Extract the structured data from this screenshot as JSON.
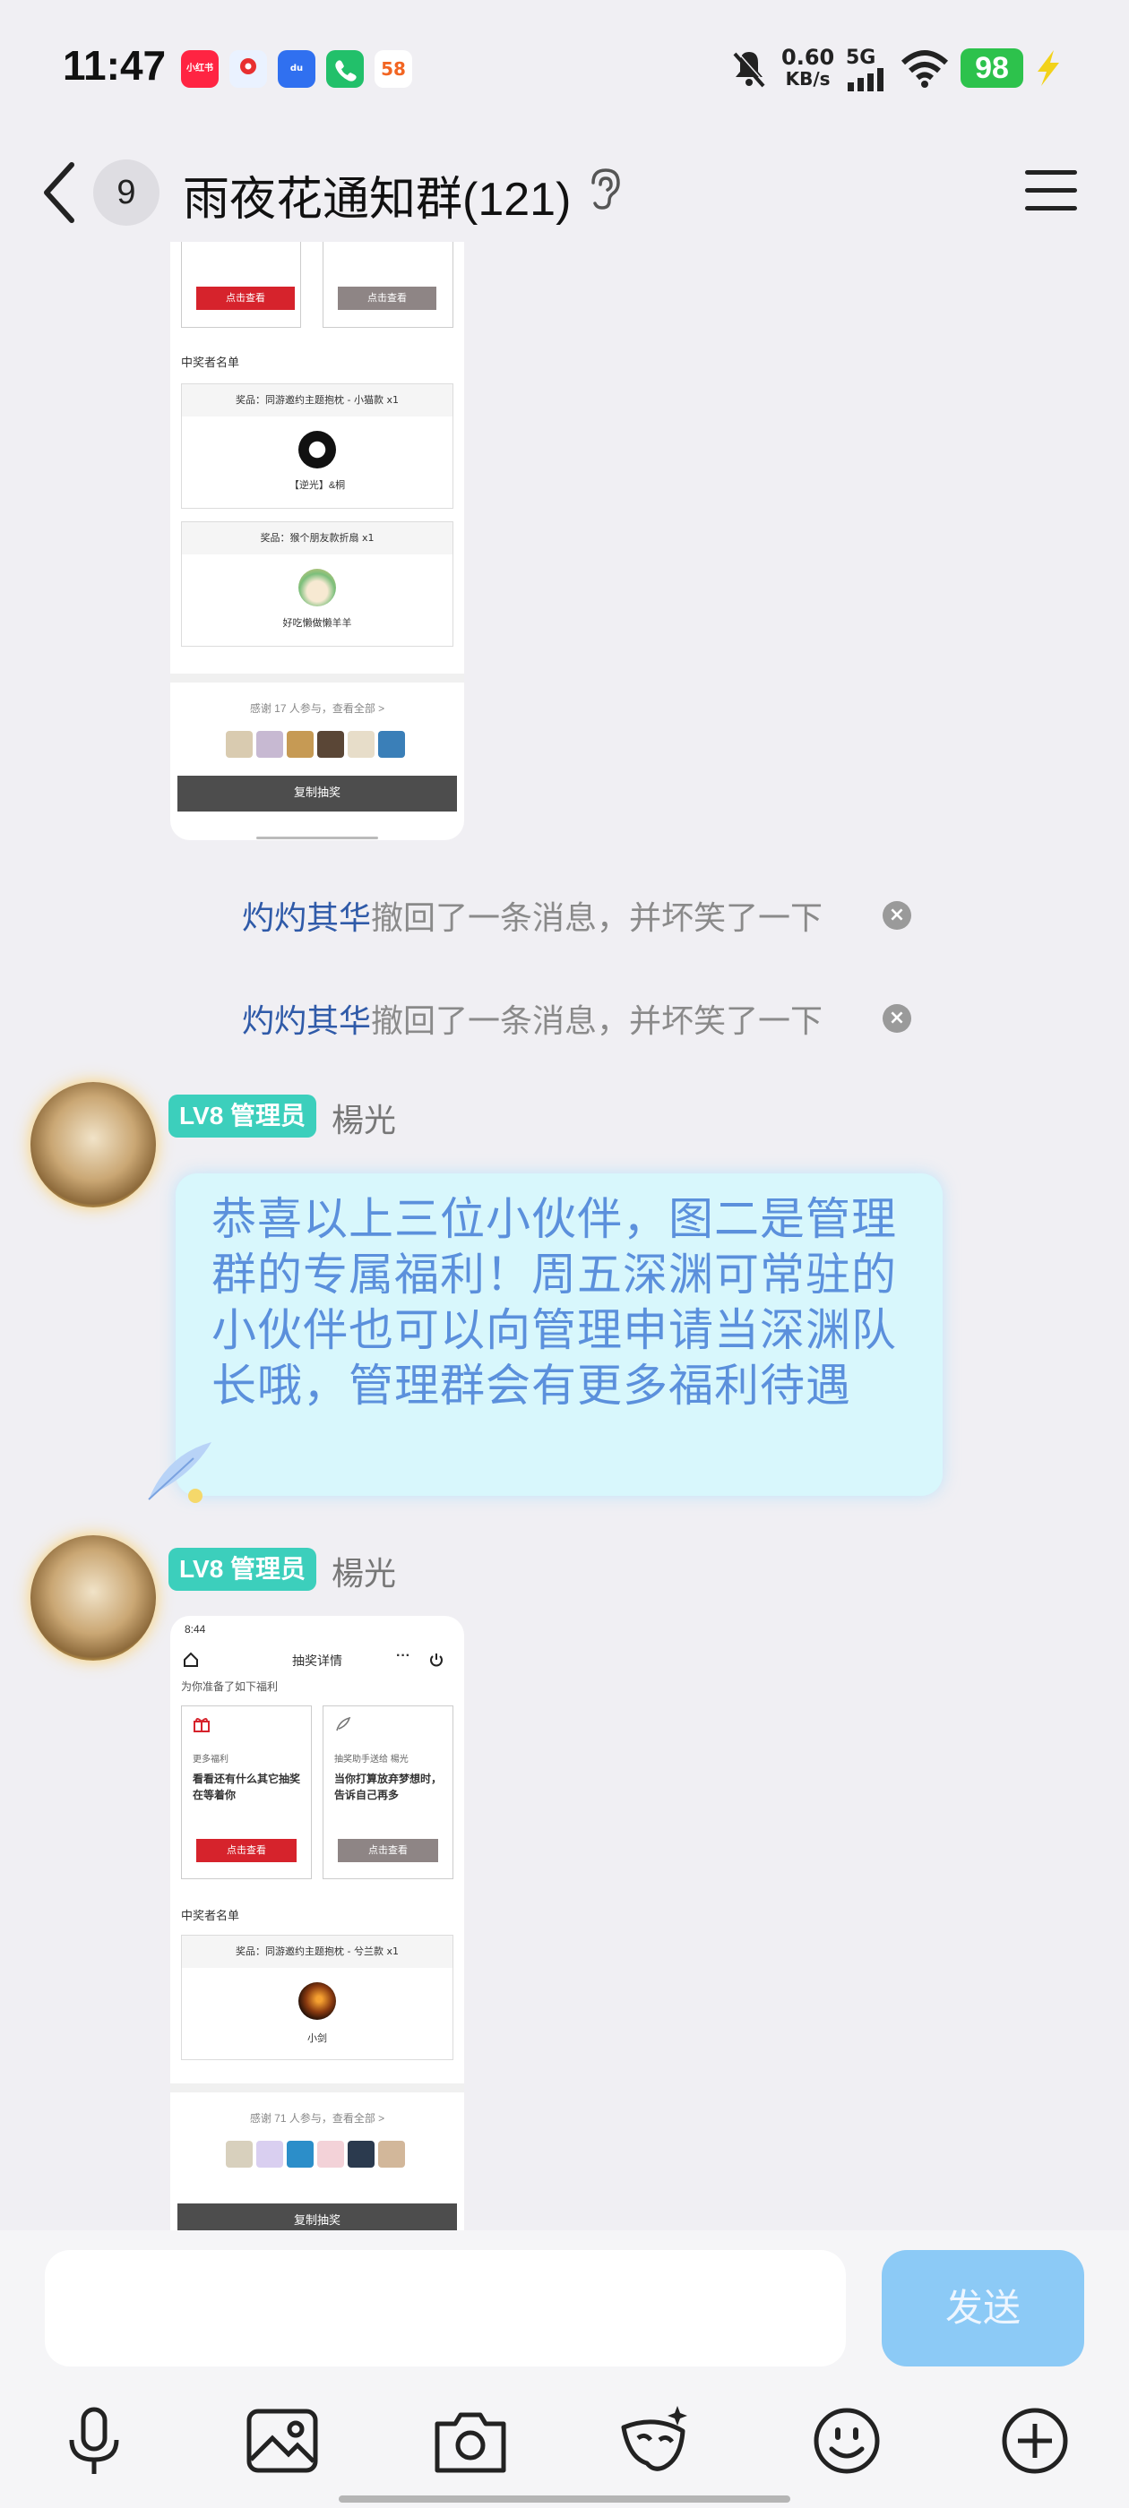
{
  "status_bar": {
    "time": "11:47",
    "apps": [
      {
        "icon": "xiaohongshu-icon",
        "label": "小红书",
        "color": "#ff2442"
      },
      {
        "icon": "map-icon",
        "label": "du",
        "color": "#e8f2ff"
      },
      {
        "icon": "baidu-icon",
        "label": "du",
        "color": "#3070f0"
      },
      {
        "icon": "phone-icon",
        "label": "",
        "color": "#22c06a"
      },
      {
        "icon": "58-icon",
        "label": "58",
        "color": "#ffffff"
      }
    ],
    "net_speed_value": "0.60",
    "net_speed_unit": "KB/s",
    "network": "5G",
    "battery": "98"
  },
  "header": {
    "unread_count": "9",
    "title": "雨夜花通知群(121)"
  },
  "card1": {
    "btn_left": "点击查看",
    "btn_right": "点击查看",
    "winners_heading": "中奖者名单",
    "prizes": [
      {
        "title": "奖品：同游邀约主题抱枕 - 小猫款 x1",
        "winner": "【逆光】&桐"
      },
      {
        "title": "奖品：猴个朋友款折扇 x1",
        "winner": "好吃懒做懒羊羊"
      }
    ],
    "thanks": "感谢 17 人参与，查看全部 >",
    "copy_label": "复制抽奖"
  },
  "recalls": [
    {
      "who": "灼灼其华",
      "text": "撤回了一条消息，并坏笑了一下"
    },
    {
      "who": "灼灼其华",
      "text": "撤回了一条消息，并坏笑了一下"
    }
  ],
  "messages": [
    {
      "level": "LV8 管理员",
      "sender": "楊光",
      "text": "恭喜以上三位小伙伴，图二是管理群的专属福利！周五深渊可常驻的小伙伴也可以向管理申请当深渊队长哦，管理群会有更多福利待遇"
    },
    {
      "level": "LV8 管理员",
      "sender": "楊光"
    }
  ],
  "card2": {
    "time": "8:44",
    "page_title": "抽奖详情",
    "more": "···",
    "prepared": "为你准备了如下福利",
    "left_box": {
      "tag": "更多福利",
      "text": "看看还有什么其它抽奖在等着你",
      "btn": "点击查看"
    },
    "right_box": {
      "tag": "抽奖助手送给 楊光",
      "text": "当你打算放弃梦想时，告诉自己再多",
      "btn": "点击查看"
    },
    "winners_heading": "中奖者名单",
    "prize_title": "奖品：同游邀约主题抱枕 - 兮兰款 x1",
    "winner": "小剑",
    "thanks": "感谢 71 人参与，查看全部 >",
    "copy_label": "复制抽奖"
  },
  "input": {
    "send_label": "发送"
  },
  "toolbar": [
    "microphone-icon",
    "image-icon",
    "camera-icon",
    "mask-icon",
    "emoji-icon",
    "plus-icon"
  ]
}
